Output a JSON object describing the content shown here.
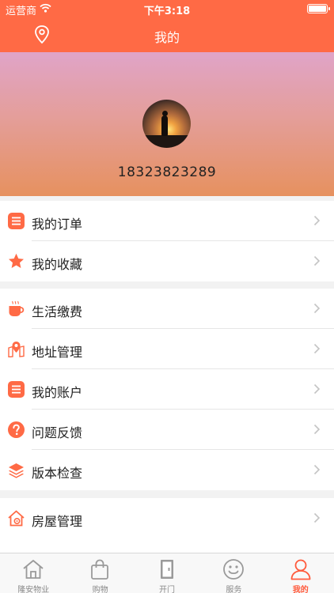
{
  "status_bar": {
    "carrier": "运营商",
    "time": "下午3:18"
  },
  "nav": {
    "title": "我的",
    "left_icon": "location-pin-icon"
  },
  "profile": {
    "phone": "18323823289"
  },
  "menu_group_1": [
    {
      "label": "我的订单",
      "icon": "order-list-icon"
    },
    {
      "label": "我的收藏",
      "icon": "star-icon"
    }
  ],
  "menu_group_2": [
    {
      "label": "生活缴费",
      "icon": "coffee-cup-icon"
    },
    {
      "label": "地址管理",
      "icon": "map-pin-icon"
    },
    {
      "label": "我的账户",
      "icon": "account-list-icon"
    },
    {
      "label": "问题反馈",
      "icon": "question-icon"
    },
    {
      "label": "版本检查",
      "icon": "layers-icon"
    }
  ],
  "menu_group_3": [
    {
      "label": "房屋管理",
      "icon": "house-settings-icon"
    }
  ],
  "tab_bar": [
    {
      "label": "隆安物业",
      "icon": "home-icon",
      "active": false
    },
    {
      "label": "购物",
      "icon": "shopping-bag-icon",
      "active": false
    },
    {
      "label": "开门",
      "icon": "door-icon",
      "active": false
    },
    {
      "label": "服务",
      "icon": "smiley-icon",
      "active": false
    },
    {
      "label": "我的",
      "icon": "user-icon",
      "active": true
    }
  ],
  "colors": {
    "accent": "#ff6a45",
    "active_tab": "#ff5a3c"
  }
}
